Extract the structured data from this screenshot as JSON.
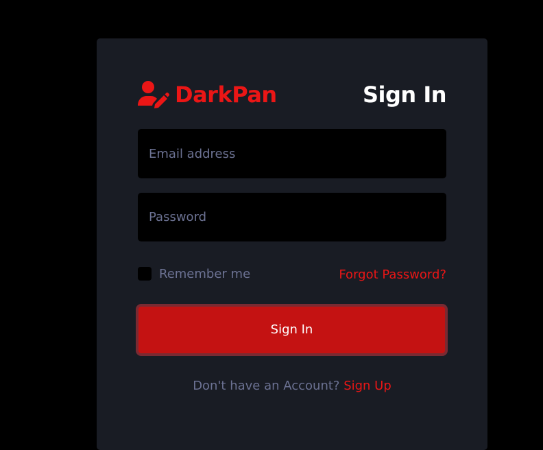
{
  "brand": {
    "name": "DarkPan",
    "icon": "user-edit-icon"
  },
  "title": "Sign In",
  "form": {
    "email": {
      "placeholder": "Email address",
      "value": ""
    },
    "password": {
      "placeholder": "Password",
      "value": ""
    },
    "remember_label": "Remember me",
    "remember_checked": false,
    "forgot_label": "Forgot Password?",
    "submit_label": "Sign In"
  },
  "footer": {
    "prompt": "Don't have an Account? ",
    "signup_label": "Sign Up"
  },
  "colors": {
    "background": "#000000",
    "card": "#191c24",
    "accent": "#eb1616",
    "button": "#c41212",
    "muted_text": "#6c7293",
    "input_bg": "#000000"
  }
}
